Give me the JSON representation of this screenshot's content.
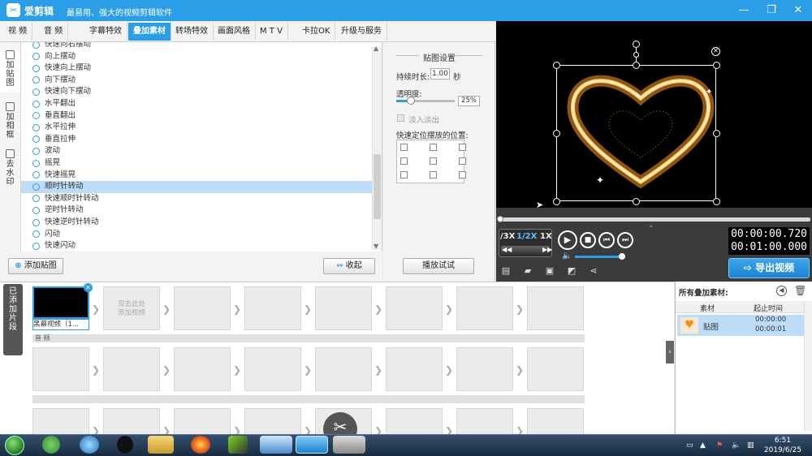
{
  "app": {
    "name": "爱剪辑",
    "slogan": "最易用、强大的视频剪辑软件"
  },
  "window_controls": {
    "minimize": "—",
    "maximize": "❐",
    "close": "✕"
  },
  "tabs": [
    "视 频",
    "音 频",
    "字幕特效",
    "叠加素材",
    "转场特效",
    "画面风格",
    "M T V",
    "卡拉OK",
    "升级与服务"
  ],
  "active_tab": "叠加素材",
  "side_tabs": [
    {
      "label": "加\n贴\n图",
      "icon": "sticker-icon"
    },
    {
      "label": "加\n相\n框",
      "icon": "frame-icon"
    },
    {
      "label": "去\n水\n印",
      "icon": "watermark-icon"
    }
  ],
  "effects": [
    {
      "label": "快速向右摆动",
      "selected": false
    },
    {
      "label": "向上摆动",
      "selected": false
    },
    {
      "label": "快速向上摆动",
      "selected": false
    },
    {
      "label": "向下摆动",
      "selected": false
    },
    {
      "label": "快速向下摆动",
      "selected": false
    },
    {
      "label": "水平翻出",
      "selected": false
    },
    {
      "label": "垂直翻出",
      "selected": false
    },
    {
      "label": "水平拉伸",
      "selected": false
    },
    {
      "label": "垂直拉伸",
      "selected": false
    },
    {
      "label": "波动",
      "selected": false
    },
    {
      "label": "摇晃",
      "selected": false
    },
    {
      "label": "快速摇晃",
      "selected": false
    },
    {
      "label": "顺时针转动",
      "selected": true
    },
    {
      "label": "快速顺时针转动",
      "selected": false
    },
    {
      "label": "逆时针转动",
      "selected": false
    },
    {
      "label": "快速逆时针转动",
      "selected": false
    },
    {
      "label": "闪动",
      "selected": false
    },
    {
      "label": "快速闪动",
      "selected": false
    }
  ],
  "list_buttons": {
    "add_sticker": "添加贴图",
    "collapse": "收起"
  },
  "settings": {
    "title": "贴图设置",
    "duration_label": "持续时长:",
    "duration_value": "1.00",
    "duration_unit": "秒",
    "opacity_label": "透明度:",
    "opacity_value": "25%",
    "opacity_level": 0.25,
    "fade_label": "淡入淡出",
    "position_label": "快速定位摆放的位置:",
    "play_test": "播放试试"
  },
  "player": {
    "speeds": [
      "/3X",
      "1/2X",
      "1X"
    ],
    "active_speed": "1/2X",
    "time_current": "00:00:00.720",
    "time_total": "00:01:00.000",
    "export": "导出视频"
  },
  "timeline": {
    "side_label": "已\n添\n加\n片\n段",
    "first_clip_label": "黑幕视频（1...",
    "placeholder": "双击此处\n添加视频",
    "audio_label": "音 频"
  },
  "right_panel": {
    "title": "所有叠加素材:",
    "col_material": "素材",
    "col_time": "起止时间",
    "row_name": "贴图",
    "row_start": "00:00:00",
    "row_end": "00:00:01"
  },
  "taskbar": {
    "time": "6:51",
    "date": "2019/6/25"
  },
  "colors": {
    "accent": "#2a9ee6",
    "selection": "#bcdcf8",
    "heart": "#ff9a1f"
  }
}
